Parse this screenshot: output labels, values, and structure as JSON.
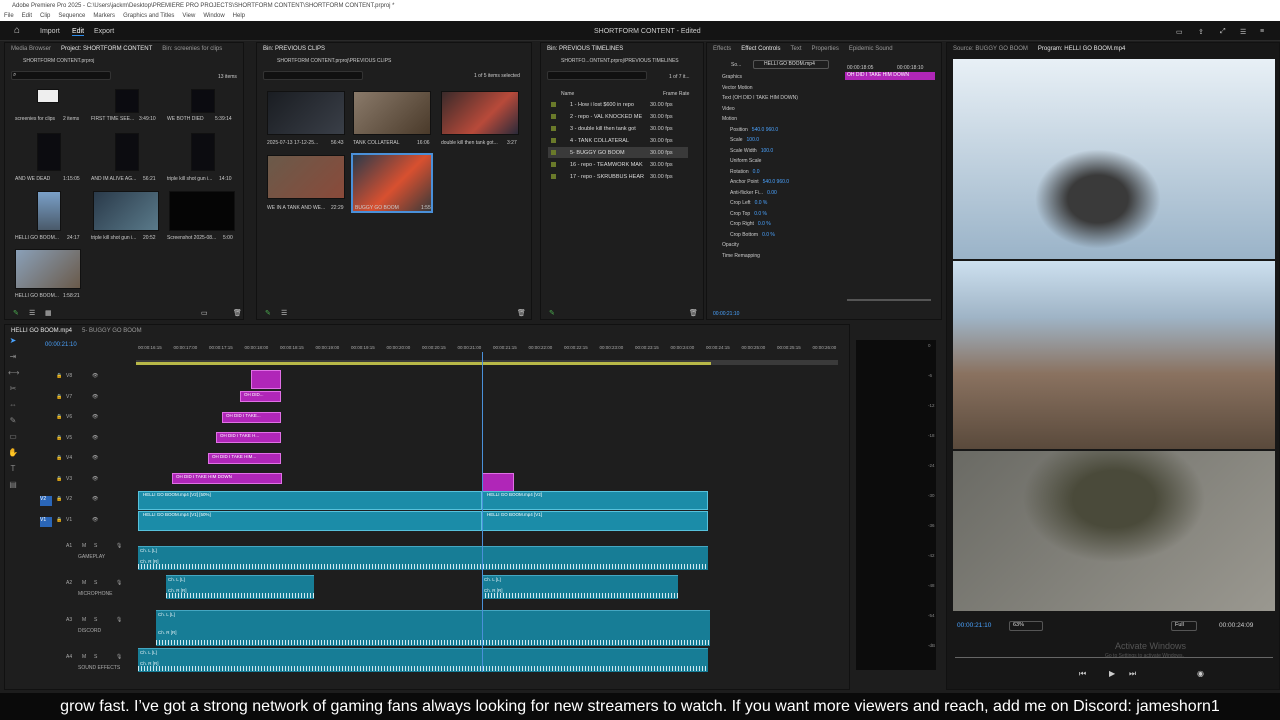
{
  "window": {
    "title": "Adobe Premiere Pro 2025 - C:\\Users\\jackm\\Desktop\\PREMIERE PRO PROJECTS\\SHORTFORM CONTENT\\SHORTFORM CONTENT.prproj *"
  },
  "menu": [
    "File",
    "Edit",
    "Clip",
    "Sequence",
    "Markers",
    "Graphics and Titles",
    "View",
    "Window",
    "Help"
  ],
  "topbar": {
    "import": "Import",
    "edit": "Edit",
    "export": "Export",
    "project_title": "SHORTFORM CONTENT - Edited"
  },
  "project_panel": {
    "tabs": [
      "Media Browser",
      "Project: SHORTFORM CONTENT",
      "Bin: screenies for clips"
    ],
    "path": "SHORTFORM CONTENT.prproj",
    "count": "13 items",
    "items": [
      {
        "name": "screenies for clips",
        "meta": "2 items"
      },
      {
        "name": "FIRST TIME SEE...",
        "meta": "3:49:10"
      },
      {
        "name": "WE BOTH DIED",
        "meta": "5:39:14"
      },
      {
        "name": "AND WE DEAD",
        "meta": "1:15:05"
      },
      {
        "name": "AND IM ALIVE AG...",
        "meta": "56:21"
      },
      {
        "name": "triple kill shot gun i...",
        "meta": "14:10"
      },
      {
        "name": "HELLI GO BOOM...",
        "meta": "24:17"
      },
      {
        "name": "triple kill shot gun i...",
        "meta": "20:52"
      },
      {
        "name": "Screenshot 2025-08...",
        "meta": "5:00"
      },
      {
        "name": "HELLI GO BOOM...",
        "meta": "1:58:21"
      }
    ]
  },
  "prev_clips_panel": {
    "tab": "Bin: PREVIOUS CLIPS",
    "path": "SHORTFORM CONTENT.prproj\\PREVIOUS CLIPS",
    "items": [
      {
        "name": "2025-07-13 17-12-25...",
        "meta": "56:43"
      },
      {
        "name": "TANK COLLATERAL",
        "meta": "16:06"
      },
      {
        "name": "double kill then tank got...",
        "meta": "3:27"
      },
      {
        "name": "WE IN A TANK AND WE...",
        "meta": "22:29"
      },
      {
        "name": "BUGGY GO BOOM",
        "meta": "1:55"
      }
    ]
  },
  "prev_timelines_panel": {
    "tab": "Bin: PREVIOUS TIMELINES",
    "path": "SHORTFO...ONTENT.prproj\\PREVIOUS TIMELINES",
    "count": "1 of 5 items selected",
    "count2": "1 of 7 it...",
    "col_name": "Name",
    "col_rate": "Frame Rate",
    "rows": [
      {
        "name": "1 - How i lost $600 in repo",
        "rate": "30.00 fps"
      },
      {
        "name": "2 - repo - VAL KNOCKED ME",
        "rate": "30.00 fps"
      },
      {
        "name": "3 - double kill then tank got",
        "rate": "30.00 fps"
      },
      {
        "name": "4 - TANK COLLATERAL",
        "rate": "30.00 fps"
      },
      {
        "name": "5- BUGGY GO BOOM",
        "rate": "30.00 fps"
      },
      {
        "name": "16 - repo - TEAMWORK MAK",
        "rate": "30.00 fps"
      },
      {
        "name": "17 - repo - SKRUBBUS HEAR",
        "rate": "30.00 fps"
      }
    ]
  },
  "effect_controls": {
    "tabs": [
      "Effects",
      "Effect Controls",
      "Text",
      "Properties",
      "Epidemic Sound"
    ],
    "source": "So...",
    "clip": "HELLI GO BOOM.mp4",
    "ruler_a": "00:00:18:05",
    "ruler_b": "00:00:18:10",
    "clip_label": "OH DID I TAKE HIM DOWN",
    "timecode": "00:00:21:10",
    "rows": [
      {
        "label": "Graphics",
        "value": ""
      },
      {
        "label": "Vector Motion",
        "value": ""
      },
      {
        "label": "Text (OH DID I TAKE HIM DOWN)",
        "value": ""
      },
      {
        "label": "Video",
        "value": ""
      },
      {
        "label": "Motion",
        "value": ""
      },
      {
        "label": "Position",
        "value": "540.0   960.0"
      },
      {
        "label": "Scale",
        "value": "100.0"
      },
      {
        "label": "Scale Width",
        "value": "100.0"
      },
      {
        "label": "Uniform Scale",
        "value": ""
      },
      {
        "label": "Rotation",
        "value": "0.0"
      },
      {
        "label": "Anchor Point",
        "value": "540.0   960.0"
      },
      {
        "label": "Anti-flicker Fi...",
        "value": "0.00"
      },
      {
        "label": "Crop Left",
        "value": "0.0 %"
      },
      {
        "label": "Crop Top",
        "value": "0.0 %"
      },
      {
        "label": "Crop Right",
        "value": "0.0 %"
      },
      {
        "label": "Crop Bottom",
        "value": "0.0 %"
      },
      {
        "label": "Opacity",
        "value": ""
      },
      {
        "label": "Time Remapping",
        "value": ""
      }
    ]
  },
  "monitor": {
    "source_tab": "Source: BUGGY GO BOOM",
    "program_tab": "Program: HELLI GO BOOM.mp4",
    "timecode": "00:00:21:10",
    "zoom": "63%",
    "quality": "Full",
    "duration": "00:00:24:09",
    "watermark1": "Activate Windows",
    "watermark2": "Go to Settings to activate Windows."
  },
  "timeline": {
    "tabs": [
      "HELLI GO BOOM.mp4",
      "5- BUGGY GO BOOM"
    ],
    "timecode": "00:00:21:10",
    "ruler": [
      "00:00:16:15",
      "00:00:17:00",
      "00:00:17:15",
      "00:00:18:00",
      "00:00:18:15",
      "00:00:19:00",
      "00:00:19:15",
      "00:00:20:00",
      "00:00:20:15",
      "00:00:21:00",
      "00:00:21:15",
      "00:00:22:00",
      "00:00:22:15",
      "00:00:23:00",
      "00:00:23:15",
      "00:00:24:00",
      "00:00:24:15",
      "00:00:25:00",
      "00:00:25:15",
      "00:00:26:00"
    ],
    "video_tracks": [
      "V8",
      "V7",
      "V6",
      "V5",
      "V4",
      "V3",
      "V2",
      "V1"
    ],
    "audio_tracks": [
      {
        "id": "A1",
        "name": "GAMEPLAY"
      },
      {
        "id": "A2",
        "name": "MICROPHONE"
      },
      {
        "id": "A3",
        "name": "DISCORD"
      },
      {
        "id": "A4",
        "name": "SOUND EFFECTS"
      }
    ],
    "text_clips": [
      "OH DID...",
      "OH DID I TAKE...",
      "OH DID I TAKE H...",
      "OH DID I TAKE HIM...",
      "OH DID I TAKE HIM DOWN"
    ],
    "v2_clip": "HELLI GO BOOM.mp4 [V2] [50%]",
    "v1_clip": "HELLI GO BOOM.mp4 [V1] [50%]",
    "v2_clip_b": "HELLI GO BOOM.mp4 [V2]",
    "v1_clip_b": "HELLI GO BOOM.mp4 [V1]",
    "ch_l": "Ch. L [L]",
    "ch_r": "Ch. R [R]",
    "meter": [
      "0",
      "-6",
      "-12",
      "-18",
      "-24",
      "-30",
      "-36",
      "-42",
      "-48",
      "-54",
      "-dB"
    ]
  },
  "caption": "grow fast. I’ve got a strong network of gaming fans always looking for new streamers to watch. If you want more viewers and reach, add me on Discord: jameshorn1"
}
